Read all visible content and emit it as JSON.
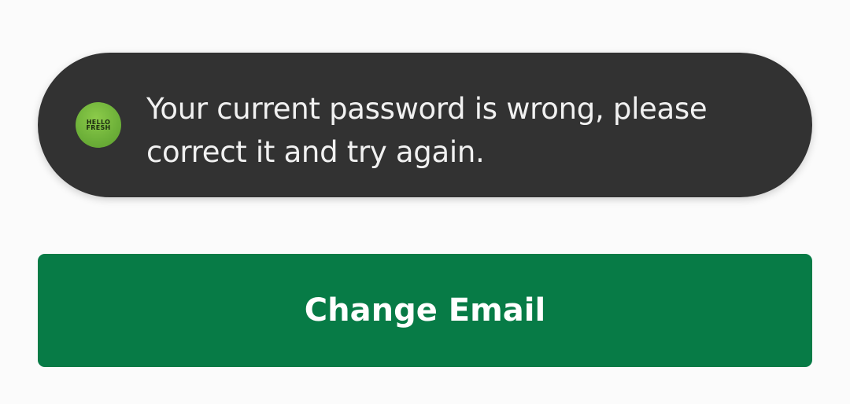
{
  "toast": {
    "logo_line1": "HELLO",
    "logo_line2": "FRESH",
    "message": "Your current password is wrong, please correct it and try again."
  },
  "button": {
    "label": "Change Email"
  },
  "colors": {
    "background": "#fbfbfb",
    "toast_background": "#323232",
    "toast_text": "#f1f1f1",
    "logo_green": "#6fb23a",
    "button_background": "#077b46",
    "button_text": "#ffffff"
  },
  "icons": {
    "toast_logo": "hellofresh-logo-icon"
  }
}
